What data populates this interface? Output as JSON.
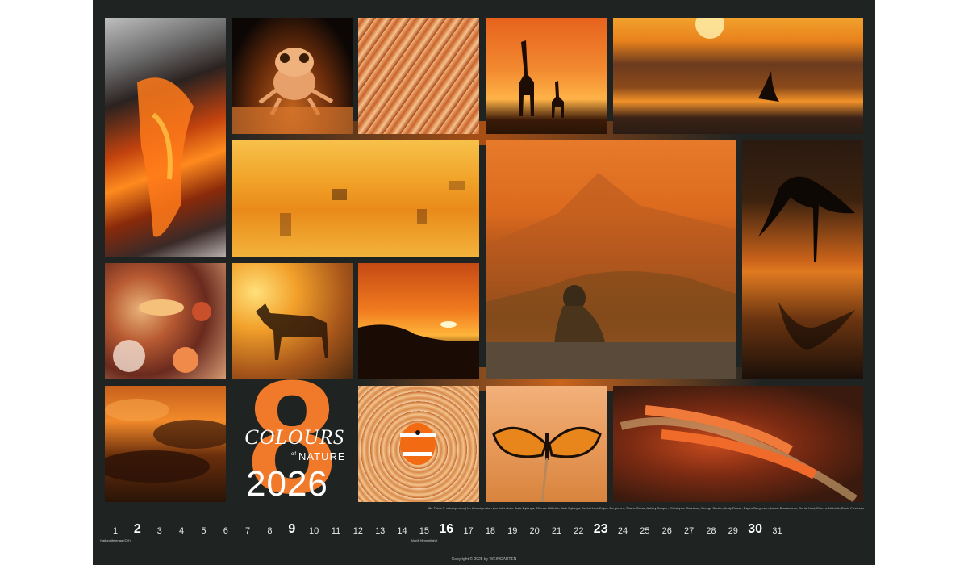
{
  "title": {
    "number": "8",
    "line1": "COLOURS",
    "of": "of",
    "line2": "NATURE",
    "year": "2026"
  },
  "photo_credits": "Alle Fotos © naturepl.com | Im Uhrzeigersinn von links oben: Jack Dykinga, Etienne Littlefair, Jack Dykinga, Denis Huot, Espen Bergersen, Shane Gross, Ashley Cooper, Christophe Courteau, George Sanker, Andy Rouse, Espen Bergersen, Lucas Bustamante, Denis Huot, Etienne Littlefair, David Fleetham",
  "copyright": "Copyright © 2025 by WEINGARTEN",
  "days": [
    {
      "n": "1",
      "big": false,
      "note": "Nationalfeiertag (CH)"
    },
    {
      "n": "2",
      "big": true,
      "note": ""
    },
    {
      "n": "3",
      "big": false,
      "note": ""
    },
    {
      "n": "4",
      "big": false,
      "note": ""
    },
    {
      "n": "5",
      "big": false,
      "note": ""
    },
    {
      "n": "6",
      "big": false,
      "note": ""
    },
    {
      "n": "7",
      "big": false,
      "note": ""
    },
    {
      "n": "8",
      "big": false,
      "note": ""
    },
    {
      "n": "9",
      "big": true,
      "note": ""
    },
    {
      "n": "10",
      "big": false,
      "note": ""
    },
    {
      "n": "11",
      "big": false,
      "note": ""
    },
    {
      "n": "12",
      "big": false,
      "note": ""
    },
    {
      "n": "13",
      "big": false,
      "note": ""
    },
    {
      "n": "14",
      "big": false,
      "note": ""
    },
    {
      "n": "15",
      "big": false,
      "note": "Mariä Himmelfahrt"
    },
    {
      "n": "16",
      "big": true,
      "note": ""
    },
    {
      "n": "17",
      "big": false,
      "note": ""
    },
    {
      "n": "18",
      "big": false,
      "note": ""
    },
    {
      "n": "19",
      "big": false,
      "note": ""
    },
    {
      "n": "20",
      "big": false,
      "note": ""
    },
    {
      "n": "21",
      "big": false,
      "note": ""
    },
    {
      "n": "22",
      "big": false,
      "note": ""
    },
    {
      "n": "23",
      "big": true,
      "note": ""
    },
    {
      "n": "24",
      "big": false,
      "note": ""
    },
    {
      "n": "25",
      "big": false,
      "note": ""
    },
    {
      "n": "26",
      "big": false,
      "note": ""
    },
    {
      "n": "27",
      "big": false,
      "note": ""
    },
    {
      "n": "28",
      "big": false,
      "note": ""
    },
    {
      "n": "29",
      "big": false,
      "note": ""
    },
    {
      "n": "30",
      "big": true,
      "note": ""
    },
    {
      "n": "31",
      "big": false,
      "note": ""
    }
  ],
  "colors": {
    "background": "#1f2322",
    "accent": "#f07a2a"
  }
}
